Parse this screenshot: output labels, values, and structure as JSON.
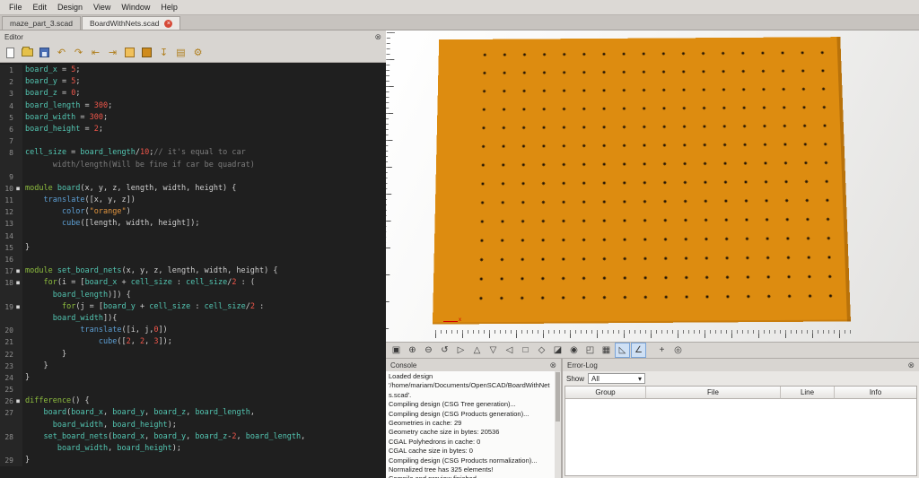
{
  "menu": {
    "items": [
      "File",
      "Edit",
      "Design",
      "View",
      "Window",
      "Help"
    ]
  },
  "tabs": {
    "items": [
      {
        "label": "maze_part_3.scad",
        "active": false
      },
      {
        "label": "BoardWithNets.scad",
        "active": true,
        "close": "×"
      }
    ]
  },
  "editor": {
    "title": "Editor",
    "close_glyph": "⊗",
    "fold_marker": "■",
    "toolbar": [
      {
        "name": "new-file-button",
        "type": "doc"
      },
      {
        "name": "open-file-button",
        "type": "folder"
      },
      {
        "name": "save-button",
        "type": "save"
      },
      {
        "name": "undo-button",
        "glyph": "↶"
      },
      {
        "name": "redo-button",
        "glyph": "↷"
      },
      {
        "name": "unindent-button",
        "glyph": "⇤"
      },
      {
        "name": "indent-button",
        "glyph": "⇥"
      },
      {
        "name": "preview-button",
        "type": "cube-light"
      },
      {
        "name": "render-button",
        "type": "cube-dark"
      },
      {
        "name": "export-button",
        "glyph": "↧"
      },
      {
        "name": "print-button",
        "glyph": "▤"
      },
      {
        "name": "customizer-button",
        "glyph": "⚙"
      }
    ],
    "lines": [
      {
        "n": "1",
        "seg": [
          [
            "board_x",
            "v"
          ],
          [
            " = ",
            "p"
          ],
          [
            "5",
            "n"
          ],
          [
            ";",
            "p"
          ]
        ]
      },
      {
        "n": "2",
        "seg": [
          [
            "board_y",
            "v"
          ],
          [
            " = ",
            "p"
          ],
          [
            "5",
            "n"
          ],
          [
            ";",
            "p"
          ]
        ]
      },
      {
        "n": "3",
        "seg": [
          [
            "board_z",
            "v"
          ],
          [
            " = ",
            "p"
          ],
          [
            "0",
            "n"
          ],
          [
            ";",
            "p"
          ]
        ]
      },
      {
        "n": "4",
        "seg": [
          [
            "board_length",
            "v"
          ],
          [
            " = ",
            "p"
          ],
          [
            "300",
            "n"
          ],
          [
            ";",
            "p"
          ]
        ]
      },
      {
        "n": "5",
        "seg": [
          [
            "board_width",
            "v"
          ],
          [
            " = ",
            "p"
          ],
          [
            "300",
            "n"
          ],
          [
            ";",
            "p"
          ]
        ]
      },
      {
        "n": "6",
        "seg": [
          [
            "board_height",
            "v"
          ],
          [
            " = ",
            "p"
          ],
          [
            "2",
            "n"
          ],
          [
            ";",
            "p"
          ]
        ]
      },
      {
        "n": "7",
        "seg": []
      },
      {
        "n": "8",
        "seg": [
          [
            "cell_size",
            "v"
          ],
          [
            " = ",
            "p"
          ],
          [
            "board_length",
            "v"
          ],
          [
            "/",
            "p"
          ],
          [
            "10",
            "n"
          ],
          [
            ";",
            "p"
          ],
          [
            "// it's equal to car",
            "c"
          ]
        ]
      },
      {
        "n": "",
        "seg": [
          [
            "      width/length(Will be fine if car be quadrat)",
            "c"
          ]
        ]
      },
      {
        "n": "9",
        "seg": []
      },
      {
        "n": "10",
        "fold": true,
        "seg": [
          [
            "module ",
            "k"
          ],
          [
            "board",
            "v"
          ],
          [
            "(x, y, z, length, width, height) {",
            "p"
          ]
        ]
      },
      {
        "n": "11",
        "seg": [
          [
            "    ",
            "p"
          ],
          [
            "translate",
            "f"
          ],
          [
            "([x, y, z])",
            "p"
          ]
        ]
      },
      {
        "n": "12",
        "seg": [
          [
            "        ",
            "p"
          ],
          [
            "color",
            "f"
          ],
          [
            "(",
            "p"
          ],
          [
            "\"orange\"",
            "s"
          ],
          [
            ")",
            "p"
          ]
        ]
      },
      {
        "n": "13",
        "seg": [
          [
            "        ",
            "p"
          ],
          [
            "cube",
            "f"
          ],
          [
            "([length, width, height]);",
            "p"
          ]
        ]
      },
      {
        "n": "14",
        "seg": []
      },
      {
        "n": "15",
        "seg": [
          [
            "}",
            "p"
          ]
        ]
      },
      {
        "n": "16",
        "seg": []
      },
      {
        "n": "17",
        "fold": true,
        "seg": [
          [
            "module ",
            "k"
          ],
          [
            "set_board_nets",
            "v"
          ],
          [
            "(x, y, z, length, width, height) {",
            "p"
          ]
        ]
      },
      {
        "n": "18",
        "fold": true,
        "seg": [
          [
            "    ",
            "p"
          ],
          [
            "for",
            "k"
          ],
          [
            "(i = [",
            "p"
          ],
          [
            "board_x",
            "v"
          ],
          [
            " + ",
            "p"
          ],
          [
            "cell_size",
            "v"
          ],
          [
            " : ",
            "p"
          ],
          [
            "cell_size",
            "v"
          ],
          [
            "/",
            "p"
          ],
          [
            "2",
            "n"
          ],
          [
            " : (",
            "p"
          ]
        ]
      },
      {
        "n": "",
        "seg": [
          [
            "      ",
            "p"
          ],
          [
            "board_length",
            "v"
          ],
          [
            ")]) {",
            "p"
          ]
        ]
      },
      {
        "n": "19",
        "fold": true,
        "seg": [
          [
            "        ",
            "p"
          ],
          [
            "for",
            "k"
          ],
          [
            "(j = [",
            "p"
          ],
          [
            "board_y",
            "v"
          ],
          [
            " + ",
            "p"
          ],
          [
            "cell_size",
            "v"
          ],
          [
            " : ",
            "p"
          ],
          [
            "cell_size",
            "v"
          ],
          [
            "/",
            "p"
          ],
          [
            "2",
            "n"
          ],
          [
            " :",
            "p"
          ]
        ]
      },
      {
        "n": "",
        "seg": [
          [
            "      ",
            "p"
          ],
          [
            "board_width",
            "v"
          ],
          [
            "]){",
            "p"
          ]
        ]
      },
      {
        "n": "20",
        "seg": [
          [
            "            ",
            "p"
          ],
          [
            "translate",
            "f"
          ],
          [
            "([i, j,",
            "p"
          ],
          [
            "0",
            "n"
          ],
          [
            "])",
            "p"
          ]
        ]
      },
      {
        "n": "21",
        "seg": [
          [
            "                ",
            "p"
          ],
          [
            "cube",
            "f"
          ],
          [
            "([",
            "p"
          ],
          [
            "2",
            "n"
          ],
          [
            ", ",
            "p"
          ],
          [
            "2",
            "n"
          ],
          [
            ", ",
            "p"
          ],
          [
            "3",
            "n"
          ],
          [
            "]);",
            "p"
          ]
        ]
      },
      {
        "n": "22",
        "seg": [
          [
            "        }",
            "p"
          ]
        ]
      },
      {
        "n": "23",
        "seg": [
          [
            "    }",
            "p"
          ]
        ]
      },
      {
        "n": "24",
        "seg": [
          [
            "}",
            "p"
          ]
        ]
      },
      {
        "n": "25",
        "seg": []
      },
      {
        "n": "26",
        "fold": true,
        "seg": [
          [
            "difference",
            "k"
          ],
          [
            "() {",
            "p"
          ]
        ]
      },
      {
        "n": "27",
        "seg": [
          [
            "    ",
            "p"
          ],
          [
            "board",
            "v"
          ],
          [
            "(",
            "p"
          ],
          [
            "board_x",
            "v"
          ],
          [
            ", ",
            "p"
          ],
          [
            "board_y",
            "v"
          ],
          [
            ", ",
            "p"
          ],
          [
            "board_z",
            "v"
          ],
          [
            ", ",
            "p"
          ],
          [
            "board_length",
            "v"
          ],
          [
            ",",
            "p"
          ]
        ]
      },
      {
        "n": "",
        "seg": [
          [
            "      ",
            "p"
          ],
          [
            "board_width",
            "v"
          ],
          [
            ", ",
            "p"
          ],
          [
            "board_height",
            "v"
          ],
          [
            ");",
            "p"
          ]
        ]
      },
      {
        "n": "28",
        "seg": [
          [
            "    ",
            "p"
          ],
          [
            "set_board_nets",
            "v"
          ],
          [
            "(",
            "p"
          ],
          [
            "board_x",
            "v"
          ],
          [
            ", ",
            "p"
          ],
          [
            "board_y",
            "v"
          ],
          [
            ", ",
            "p"
          ],
          [
            "board_z",
            "v"
          ],
          [
            "-",
            "p"
          ],
          [
            "2",
            "n"
          ],
          [
            ", ",
            "p"
          ],
          [
            "board_length",
            "v"
          ],
          [
            ",",
            "p"
          ]
        ]
      },
      {
        "n": "",
        "seg": [
          [
            "       ",
            "p"
          ],
          [
            "board_width",
            "v"
          ],
          [
            ", ",
            "p"
          ],
          [
            "board_height",
            "v"
          ],
          [
            ");",
            "p"
          ]
        ]
      },
      {
        "n": "29",
        "seg": [
          [
            "}",
            "p"
          ]
        ]
      }
    ]
  },
  "viewport": {
    "axis_label": "x"
  },
  "view_toolbar": {
    "buttons": [
      {
        "name": "zoom-all-button",
        "glyph": "▣"
      },
      {
        "name": "zoom-in-button",
        "glyph": "⊕"
      },
      {
        "name": "zoom-out-button",
        "glyph": "⊖"
      },
      {
        "name": "reset-view-button",
        "glyph": "↺"
      },
      {
        "name": "view-right-button",
        "glyph": "▷"
      },
      {
        "name": "view-top-button",
        "glyph": "△"
      },
      {
        "name": "view-bottom-button",
        "glyph": "▽"
      },
      {
        "name": "view-left-button",
        "glyph": "◁"
      },
      {
        "name": "view-front-button",
        "glyph": "□"
      },
      {
        "name": "view-back-button",
        "glyph": "◇"
      },
      {
        "name": "view-diagonal-button",
        "glyph": "◪"
      },
      {
        "name": "view-center-button",
        "glyph": "◉"
      },
      {
        "name": "perspective-button",
        "glyph": "◰"
      },
      {
        "name": "orthogonal-button",
        "glyph": "▦"
      },
      {
        "name": "measure-distance-button",
        "glyph": "◺",
        "active": true
      },
      {
        "name": "measure-angle-button",
        "glyph": "∠",
        "active": true
      },
      {
        "name": "show-axes-button",
        "glyph": "+",
        "gap": true
      },
      {
        "name": "show-crosshair-button",
        "glyph": "◎"
      }
    ]
  },
  "console": {
    "title": "Console",
    "close_glyph": "⊗",
    "lines": [
      "Loaded design '/home/mariam/Documents/OpenSCAD/BoardWithNets.scad'.",
      "Compiling design (CSG Tree generation)...",
      "Compiling design (CSG Products generation)...",
      "Geometries in cache: 29",
      "Geometry cache size in bytes: 20536",
      "CGAL Polyhedrons in cache: 0",
      "CGAL cache size in bytes: 0",
      "Compiling design (CSG Products normalization)...",
      "Normalized tree has 325 elements!",
      "Compile and preview finished."
    ]
  },
  "error_log": {
    "title": "Error-Log",
    "close_glyph": "⊗",
    "show_label": "Show",
    "filter": {
      "value": "All",
      "arrow": "▾"
    },
    "columns": [
      "Group",
      "File",
      "Line",
      "Info"
    ]
  },
  "colors": {
    "board": "#dd8c10",
    "hole": "#201305",
    "axis_red": "#d40000",
    "tab_close_red": "#d64937"
  }
}
